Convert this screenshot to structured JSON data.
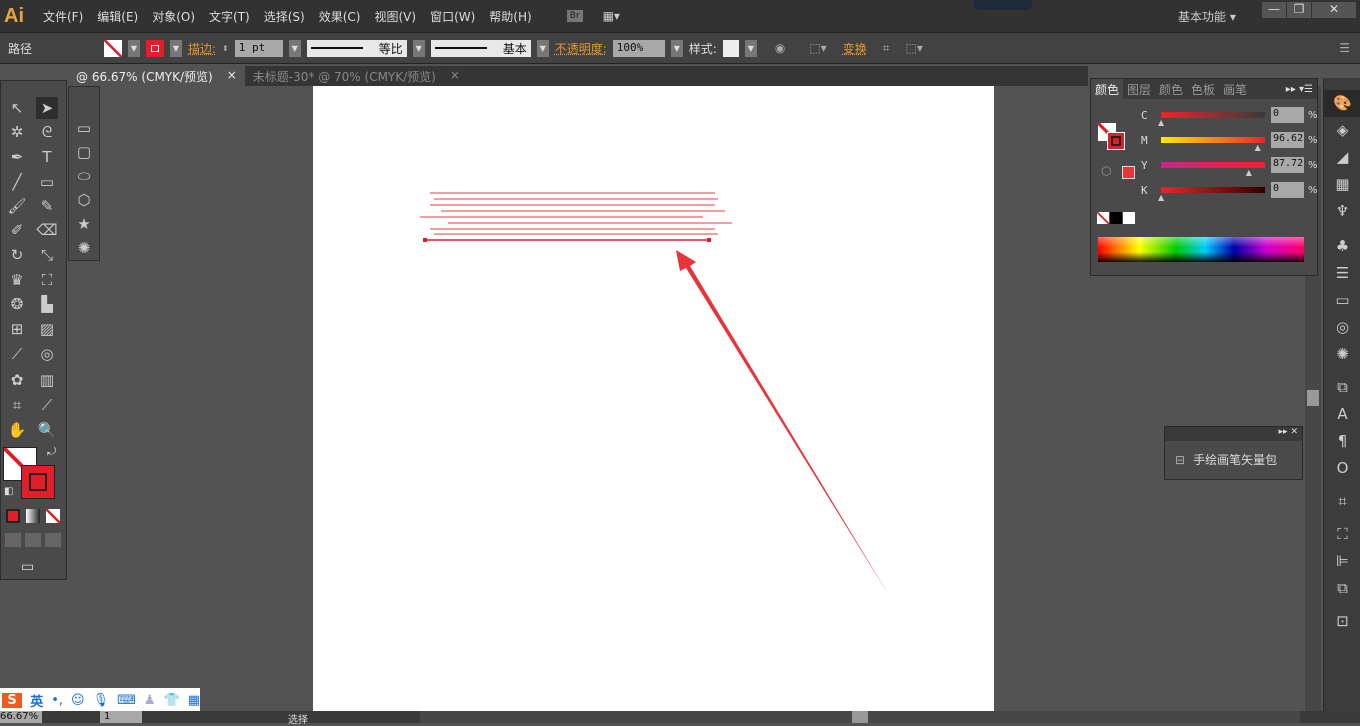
{
  "app": {
    "logo": "Ai"
  },
  "menu": [
    "文件(F)",
    "编辑(E)",
    "对象(O)",
    "文字(T)",
    "选择(S)",
    "效果(C)",
    "视图(V)",
    "窗口(W)",
    "帮助(H)"
  ],
  "menu_icons": {
    "bridge": "Br"
  },
  "workspace": "基本功能",
  "control": {
    "selection_type": "路径",
    "stroke_label": "描边:",
    "stroke_weight": "1 pt",
    "profile1": "等比",
    "profile2": "基本",
    "opacity_label": "不透明度:",
    "opacity": "100%",
    "style_label": "样式:",
    "transform_label": "变换"
  },
  "tabs": [
    {
      "label": "@ 66.67% (CMYK/预览)",
      "close": "×"
    },
    {
      "label": "未标题-30* @ 70% (CMYK/预览)",
      "close": "×"
    }
  ],
  "color_panel": {
    "tabs": [
      "颜色",
      "图层",
      "颜色",
      "色板",
      "画笔"
    ],
    "channels": [
      {
        "name": "C",
        "value": "0",
        "pos": 0
      },
      {
        "name": "M",
        "value": "96.62",
        "pos": 0.966
      },
      {
        "name": "Y",
        "value": "87.72",
        "pos": 0.877
      },
      {
        "name": "K",
        "value": "0",
        "pos": 0
      }
    ],
    "percent": "%",
    "fill_color": "#e8343a"
  },
  "brush_panel": {
    "item": "手绘画笔矢量包"
  },
  "status": {
    "zoom": "66.67%",
    "page": "1",
    "tool": "选择"
  },
  "ime": {
    "lang": "英",
    "punct": "•,"
  },
  "colors": {
    "accent": "#e8962e",
    "stroke": "#e31e2b",
    "lines": "#e8636b",
    "arrow": "#e8333a"
  }
}
